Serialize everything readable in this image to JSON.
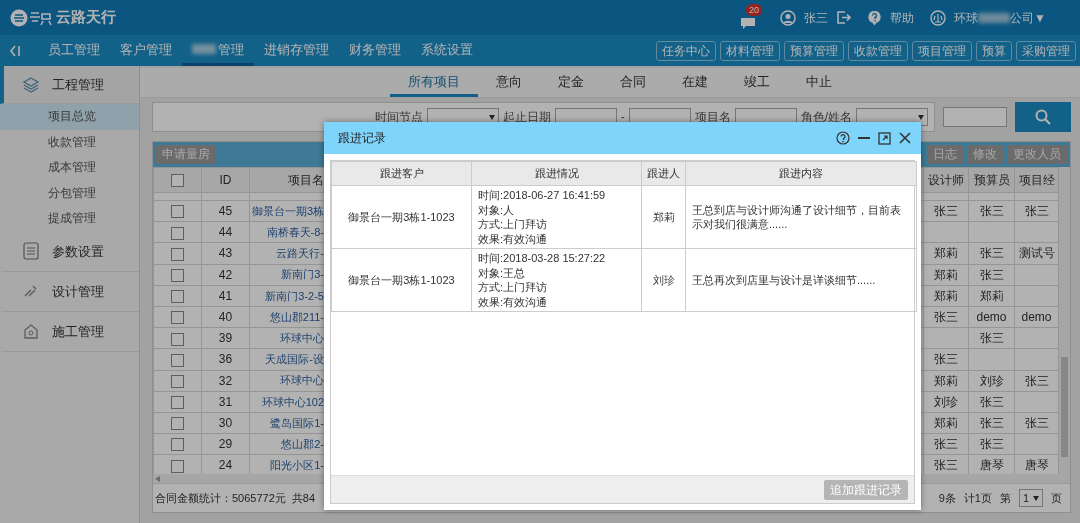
{
  "brand": "云路天行",
  "header": {
    "notification_count": "20",
    "user": "张三",
    "help": "帮助",
    "company": [
      "环球",
      "公司"
    ],
    "company_caret": "▼"
  },
  "nav": {
    "items": [
      {
        "label": "员工管理",
        "selected": false,
        "redacted": false
      },
      {
        "label": "客户管理",
        "selected": false,
        "redacted": false
      },
      {
        "label": "管理",
        "selected": true,
        "redacted": true
      },
      {
        "label": "进销存管理",
        "selected": false,
        "redacted": false
      },
      {
        "label": "财务管理",
        "selected": false,
        "redacted": false
      },
      {
        "label": "系统设置",
        "selected": false,
        "redacted": false
      }
    ],
    "quick_buttons": [
      "任务中心",
      "材料管理",
      "预算管理",
      "收款管理",
      "项目管理",
      "预算",
      "采购管理"
    ]
  },
  "sidebar": {
    "sections": [
      {
        "label": "工程管理",
        "kind": "layers",
        "expanded": true,
        "selected": true,
        "children": [
          {
            "label": "项目总览",
            "selected": true
          },
          {
            "label": "收款管理",
            "selected": false
          },
          {
            "label": "成本管理",
            "selected": false
          },
          {
            "label": "分包管理",
            "selected": false
          },
          {
            "label": "提成管理",
            "selected": false
          }
        ]
      },
      {
        "label": "参数设置",
        "kind": "list",
        "expanded": false,
        "selected": false
      },
      {
        "label": "设计管理",
        "kind": "design",
        "expanded": false,
        "selected": false
      },
      {
        "label": "施工管理",
        "kind": "house",
        "expanded": false,
        "selected": false
      }
    ]
  },
  "tabs": [
    {
      "label": "所有项目",
      "selected": true
    },
    {
      "label": "意向",
      "selected": false
    },
    {
      "label": "定金",
      "selected": false
    },
    {
      "label": "合同",
      "selected": false
    },
    {
      "label": "在建",
      "selected": false
    },
    {
      "label": "竣工",
      "selected": false
    },
    {
      "label": "中止",
      "selected": false
    }
  ],
  "filters": {
    "time_node_label": "时间节点",
    "date_range_label": "起止日期",
    "date_separator": "-",
    "project_name_label": "项目名",
    "role_label": "角色/姓名"
  },
  "grid": {
    "left_buttons": [
      "申请量房"
    ],
    "right_buttons": [
      "日志",
      "修改",
      "更改人员"
    ],
    "select_all_checked": false,
    "columns": {
      "id": "ID",
      "name": "项目名",
      "designer": "设计师",
      "budgeter": "预算员",
      "manager": "项目经"
    },
    "rows": [
      {
        "checked": false,
        "id": "45",
        "name": "御景台一期3栋",
        "designer": "张三",
        "budgeter": "张三",
        "manager": "张三"
      },
      {
        "checked": false,
        "id": "44",
        "name": "南桥春天-8-",
        "designer": "",
        "budgeter": "",
        "manager": ""
      },
      {
        "checked": false,
        "id": "43",
        "name": "云路天行-",
        "designer": "郑莉",
        "budgeter": "张三",
        "manager": "测试号"
      },
      {
        "checked": false,
        "id": "42",
        "name": "新南门3-",
        "designer": "郑莉",
        "budgeter": "张三",
        "manager": ""
      },
      {
        "checked": false,
        "id": "41",
        "name": "新南门3-2-5",
        "designer": "郑莉",
        "budgeter": "郑莉",
        "manager": ""
      },
      {
        "checked": false,
        "id": "40",
        "name": "悠山郡211-",
        "designer": "张三",
        "budgeter": "demo",
        "manager": "demo"
      },
      {
        "checked": false,
        "id": "39",
        "name": "环球中心",
        "designer": "",
        "budgeter": "张三",
        "manager": ""
      },
      {
        "checked": false,
        "id": "36",
        "name": "天成国际-设",
        "designer": "张三",
        "budgeter": "",
        "manager": ""
      },
      {
        "checked": false,
        "id": "32",
        "name": "环球中心",
        "designer": "郑莉",
        "budgeter": "刘珍",
        "manager": "张三"
      },
      {
        "checked": false,
        "id": "31",
        "name": "环球中心102",
        "designer": "刘珍",
        "budgeter": "张三",
        "manager": ""
      },
      {
        "checked": false,
        "id": "30",
        "name": "鹭岛国际1-",
        "designer": "郑莉",
        "budgeter": "张三",
        "manager": "张三"
      },
      {
        "checked": false,
        "id": "29",
        "name": "悠山郡2-",
        "designer": "张三",
        "budgeter": "张三",
        "manager": ""
      },
      {
        "checked": false,
        "id": "24",
        "name": "阳光小区1-",
        "designer": "张三",
        "budgeter": "唐琴",
        "manager": "唐琴"
      }
    ],
    "footer": {
      "total": "合同金额统计：5065772元",
      "count": "共84",
      "records": "9条",
      "pages": "计1页",
      "page_prefix": "第",
      "page": "1",
      "page_suffix": "页"
    }
  },
  "dialog": {
    "title": "跟进记录",
    "columns": [
      "跟进客户",
      "跟进情况",
      "跟进人",
      "跟进内容"
    ],
    "rows": [
      {
        "customer": "御景台一期3栋1-1023",
        "details": [
          "时间:2018-06-27 16:41:59",
          "对象:人",
          "方式:上门拜访",
          "效果:有效沟通"
        ],
        "person": "郑莉",
        "content": "王总到店与设计师沟通了设计细节，目前表示对我们很满意......"
      },
      {
        "customer": "御景台一期3栋1-1023",
        "details": [
          "时间:2018-03-28 15:27:22",
          "对象:王总",
          "方式:上门拜访",
          "效果:有效沟通"
        ],
        "person": "刘珍",
        "content": "王总再次到店里与设计是详谈细节......"
      }
    ],
    "add_button": "追加跟进记录"
  }
}
